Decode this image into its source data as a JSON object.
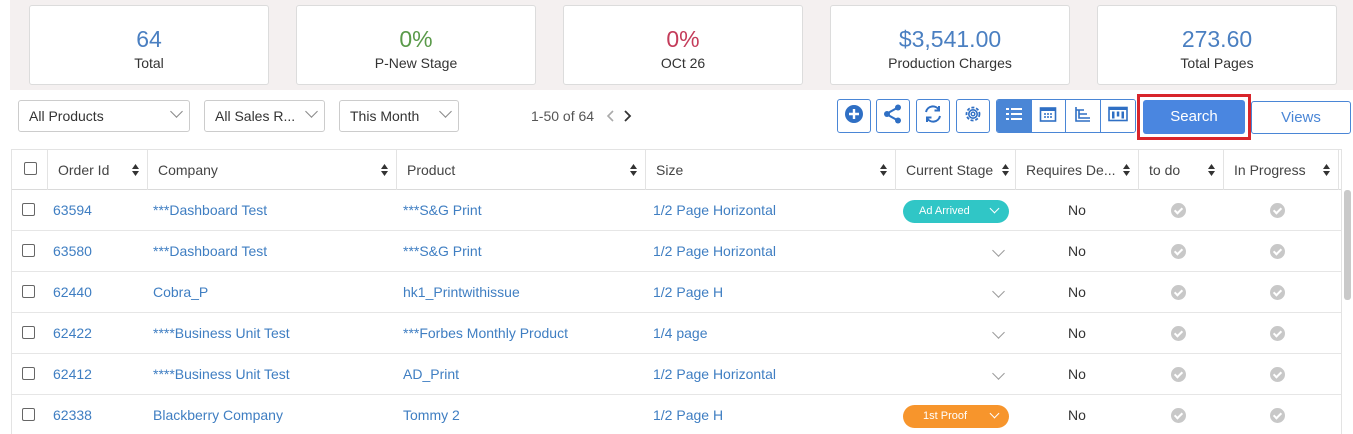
{
  "stats": [
    {
      "value": "64",
      "label": "Total",
      "color": "#4a7fc1"
    },
    {
      "value": "0%",
      "label": "P-New Stage",
      "color": "#5a9a4a"
    },
    {
      "value": "0%",
      "label": "OCt 26",
      "color": "#c43c5a"
    },
    {
      "value": "$3,541.00",
      "label": "Production Charges",
      "color": "#4a7fc1"
    },
    {
      "value": "273.60",
      "label": "Total Pages",
      "color": "#4a7fc1"
    }
  ],
  "filters": {
    "products": "All Products",
    "sales_rep": "All Sales R...",
    "period": "This Month"
  },
  "pager": {
    "text": "1-50 of 64"
  },
  "toolbar": {
    "icons": [
      "add-icon",
      "share-icon",
      "refresh-icon",
      "gear-icon"
    ],
    "views": [
      "list-view-icon",
      "calendar-view-icon",
      "tree-view-icon",
      "board-view-icon"
    ],
    "search_label": "Search",
    "views_label": "Views",
    "accent": "#4a86d6",
    "highlight": "#d8252b"
  },
  "table": {
    "headers": [
      "Order Id",
      "Company",
      "Product",
      "Size",
      "Current Stage",
      "Requires De...",
      "to do",
      "In Progress"
    ],
    "rows": [
      {
        "order_id": "63594",
        "company": "***Dashboard Test",
        "product": "***S&G Print",
        "size": "1/2 Page Horizontal",
        "stage": "Ad Arrived",
        "stage_color": "#30c6c6",
        "requires": "No"
      },
      {
        "order_id": "63580",
        "company": "***Dashboard Test",
        "product": "***S&G Print",
        "size": "1/2 Page Horizontal",
        "stage": "",
        "stage_color": "",
        "requires": "No"
      },
      {
        "order_id": "62440",
        "company": "Cobra_P",
        "product": "hk1_Printwithissue",
        "size": "1/2 Page H",
        "stage": "",
        "stage_color": "",
        "requires": "No"
      },
      {
        "order_id": "62422",
        "company": "****Business Unit Test",
        "product": "***Forbes Monthly Product",
        "size": "1/4 page",
        "stage": "",
        "stage_color": "",
        "requires": "No"
      },
      {
        "order_id": "62412",
        "company": "****Business Unit Test",
        "product": "AD_Print",
        "size": "1/2 Page Horizontal",
        "stage": "",
        "stage_color": "",
        "requires": "No"
      },
      {
        "order_id": "62338",
        "company": "Blackberry Company",
        "product": "Tommy 2",
        "size": "1/2 Page H",
        "stage": "1st Proof",
        "stage_color": "#f7952c",
        "requires": "No"
      }
    ]
  }
}
